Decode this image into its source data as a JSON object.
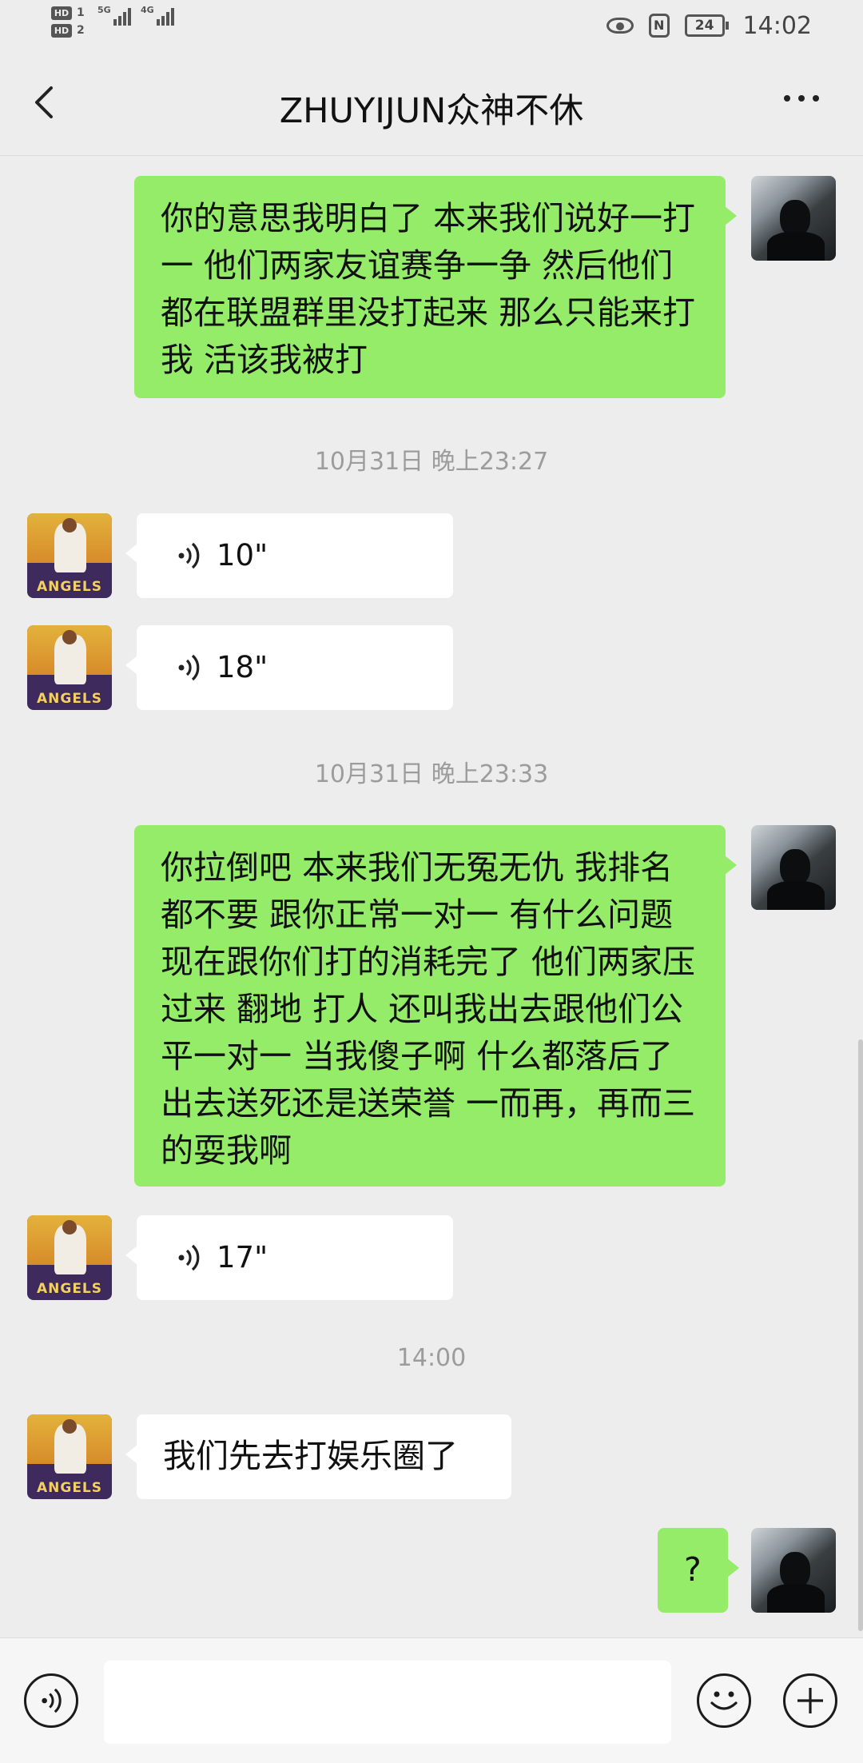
{
  "status_bar": {
    "sim1": "HD",
    "sim1_num": "1",
    "sim2": "HD",
    "sim2_num": "2",
    "net1": "5G",
    "net2": "4G",
    "nfc": "N",
    "battery": "24",
    "time": "14:02"
  },
  "header": {
    "title": "ZHUYIJUN众神不休"
  },
  "avatars": {
    "other_text": "ANGELS"
  },
  "messages": {
    "m1": "你的意思我明白了 本来我们说好一打一 他们两家友谊赛争一争  然后他们都在联盟群里没打起来 那么只能来打我  活该我被打",
    "ts1": "10月31日 晚上23:27",
    "v1": "10\"",
    "v2": "18\"",
    "ts2": "10月31日 晚上23:33",
    "m2": "你拉倒吧 本来我们无冤无仇 我排名都不要 跟你正常一对一 有什么问题   现在跟你们打的消耗完了  他们两家压过来 翻地 打人  还叫我出去跟他们公平一对一 当我傻子啊 什么都落后了 出去送死还是送荣誉 一而再，再而三的耍我啊",
    "v3": "17\"",
    "ts3": "14:00",
    "m3": "我们先去打娱乐圈了",
    "m4": "?"
  },
  "input_bar": {
    "voice_icon": "voice-icon",
    "emoji_icon": "emoji-icon",
    "plus_icon": "plus-icon"
  }
}
